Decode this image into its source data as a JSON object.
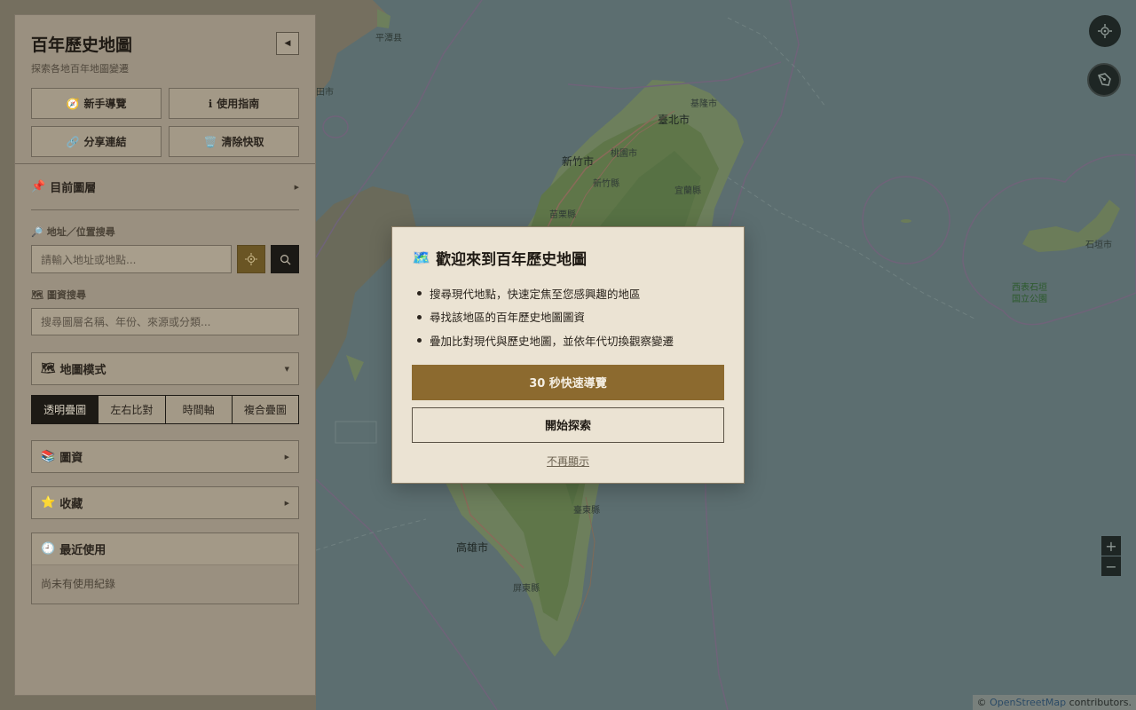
{
  "sidebar": {
    "title": "百年歷史地圖",
    "subtitle": "探索各地百年地圖變遷",
    "actions": [
      {
        "icon": "🧭",
        "label": "新手導覽"
      },
      {
        "icon": "ℹ",
        "label": "使用指南"
      },
      {
        "icon": "🔗",
        "label": "分享連結"
      },
      {
        "icon": "🗑️",
        "label": "清除快取"
      }
    ],
    "current_layers": {
      "icon": "📌",
      "label": "目前圖層"
    },
    "address_search": {
      "icon": "🔎",
      "label": "地址／位置搜尋",
      "placeholder": "請輸入地址或地點..."
    },
    "layer_search": {
      "icon": "🗺",
      "label": "圖資搜尋",
      "placeholder": "搜尋圖層名稱、年份、來源或分類..."
    },
    "map_mode": {
      "icon": "🗺",
      "label": "地圖模式",
      "options": [
        "透明疊圖",
        "左右比對",
        "時間軸",
        "複合疊圖"
      ],
      "selected": "透明疊圖"
    },
    "datasets": {
      "icon": "📚",
      "label": "圖資"
    },
    "favorites": {
      "icon": "⭐",
      "label": "收藏"
    },
    "recent": {
      "icon": "🕘",
      "label": "最近使用",
      "empty_text": "尚未有使用紀錄"
    }
  },
  "map": {
    "labels": {
      "taipei": "臺北市",
      "keelung": "基隆市",
      "hsinchu_city": "新竹市",
      "taoyuan": "桃園市",
      "hsinchu_county": "新竹縣",
      "yilan": "宜蘭縣",
      "miaoli": "苗栗縣",
      "taitung": "臺東縣",
      "kaohsiung": "高雄市",
      "pingtung": "屏東縣",
      "pingtan": "平潭县",
      "ishigaki": "石垣市",
      "park_line1": "西表石垣",
      "park_line2": "国立公園",
      "top_edge": "莆田市",
      "left_tian": "田市"
    },
    "zoom_in": "+",
    "zoom_out": "−",
    "attribution_prefix": "©",
    "attribution_link": "OpenStreetMap",
    "attribution_suffix": "contributors."
  },
  "modal": {
    "icon": "🗺️",
    "title": "歡迎來到百年歷史地圖",
    "bullets": [
      "搜尋現代地點，快速定焦至您感興趣的地區",
      "尋找該地區的百年歷史地圖圖資",
      "疊加比對現代與歷史地圖，並依年代切換觀察變遷"
    ],
    "tour_button": "30 秒快速導覽",
    "start_button": "開始探索",
    "dismiss_link": "不再顯示"
  }
}
